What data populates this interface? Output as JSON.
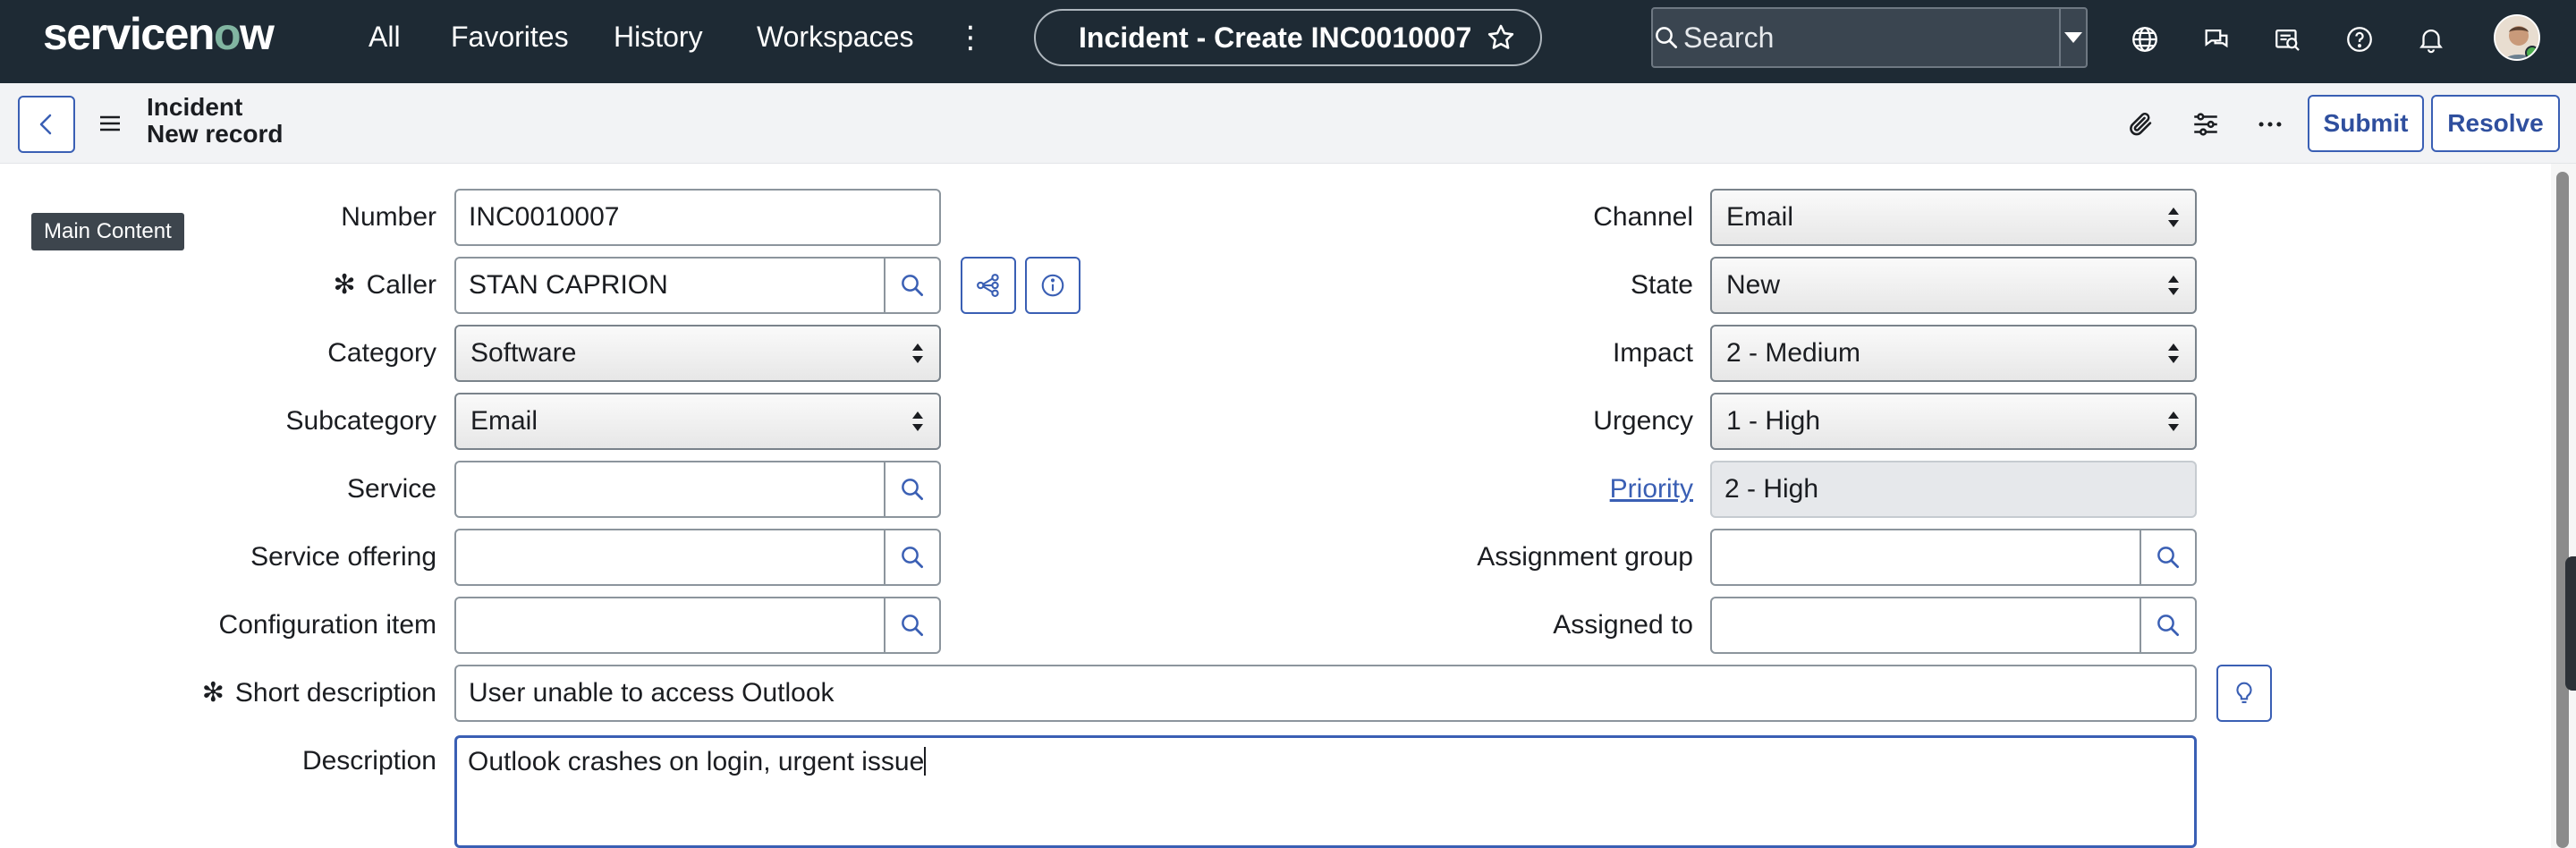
{
  "nav": {
    "logo_pre": "servicen",
    "logo_o": "o",
    "logo_post": "w",
    "links": [
      "All",
      "Favorites",
      "History",
      "Workspaces"
    ],
    "window_title": "Incident - Create INC0010007",
    "search_placeholder": "Search",
    "icons": [
      "globe-icon",
      "chat-icon",
      "workspace-icon",
      "help-icon",
      "bell-icon"
    ]
  },
  "header": {
    "record_type": "Incident",
    "record_state": "New record",
    "submit_label": "Submit",
    "resolve_label": "Resolve"
  },
  "tooltip": "Main Content",
  "form": {
    "left": {
      "number": {
        "label": "Number",
        "value": "INC0010007"
      },
      "caller": {
        "label": "Caller",
        "value": "STAN CAPRION",
        "required": true
      },
      "category": {
        "label": "Category",
        "value": "Software"
      },
      "subcategory": {
        "label": "Subcategory",
        "value": "Email"
      },
      "service": {
        "label": "Service",
        "value": ""
      },
      "service_offering": {
        "label": "Service offering",
        "value": ""
      },
      "configuration_item": {
        "label": "Configuration item",
        "value": ""
      }
    },
    "right": {
      "channel": {
        "label": "Channel",
        "value": "Email"
      },
      "state": {
        "label": "State",
        "value": "New"
      },
      "impact": {
        "label": "Impact",
        "value": "2 - Medium"
      },
      "urgency": {
        "label": "Urgency",
        "value": "1 - High"
      },
      "priority": {
        "label": "Priority",
        "value": "2 - High"
      },
      "assignment_group": {
        "label": "Assignment group",
        "value": ""
      },
      "assigned_to": {
        "label": "Assigned to",
        "value": ""
      }
    },
    "short_description": {
      "label": "Short description",
      "value": "User unable to access Outlook",
      "required": true
    },
    "description": {
      "label": "Description",
      "value": "Outlook crashes on login, urgent issue"
    }
  },
  "colors": {
    "nav_bg": "#1e2a34",
    "accent": "#3a5fb4",
    "logo_o": "#81b5a1"
  }
}
